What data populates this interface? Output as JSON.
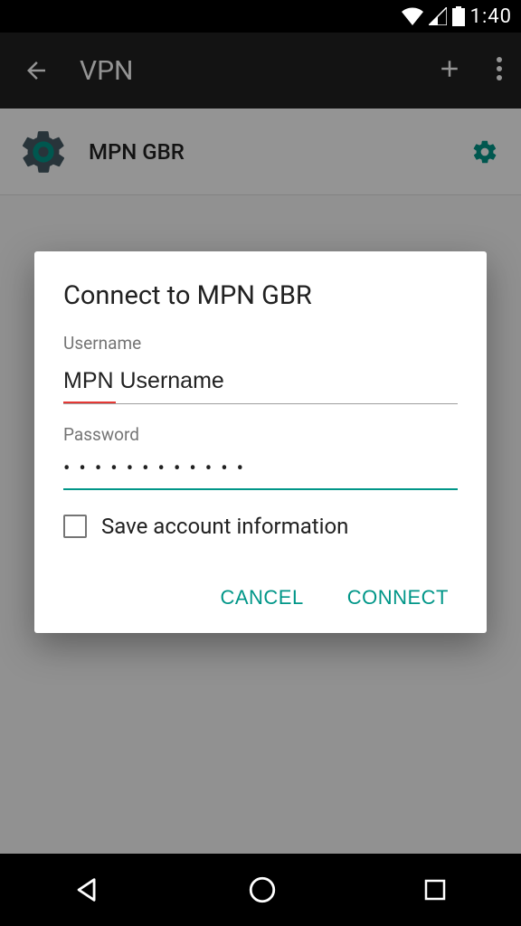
{
  "status": {
    "time": "1:40"
  },
  "appbar": {
    "title": "VPN"
  },
  "vpn_list": {
    "items": [
      {
        "name": "MPN GBR"
      }
    ]
  },
  "dialog": {
    "title": "Connect to MPN GBR",
    "username_label": "Username",
    "username_value": "MPN Username",
    "password_label": "Password",
    "password_masked": "••••••••••••",
    "save_info_label": "Save account information",
    "save_info_checked": false,
    "cancel_label": "CANCEL",
    "connect_label": "CONNECT"
  },
  "colors": {
    "accent": "#009688"
  }
}
